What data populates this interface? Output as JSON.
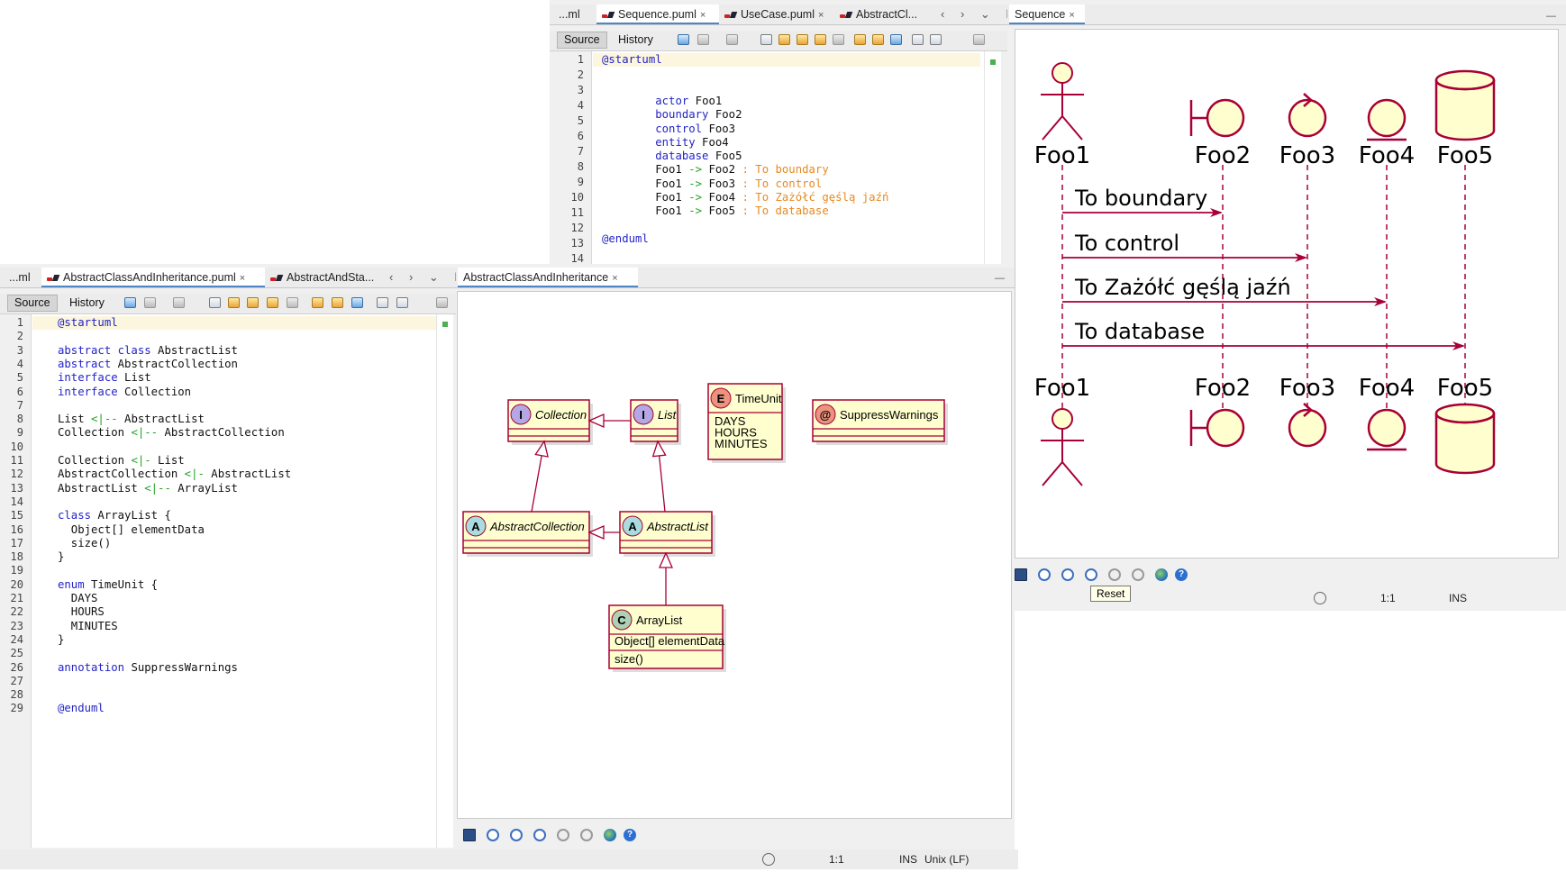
{
  "top_editor": {
    "tabs": [
      {
        "label": "...ml"
      },
      {
        "label": "Sequence.puml",
        "close": "×"
      },
      {
        "label": "UseCase.puml",
        "close": "×"
      },
      {
        "label": "AbstractCl..."
      }
    ],
    "nav": "‹ › ⌄ ☐",
    "source_label": "Source",
    "history_label": "History",
    "line_numbers": [
      "1",
      "2",
      "3",
      "4",
      "5",
      "6",
      "7",
      "8",
      "9",
      "10",
      "11",
      "12",
      "13",
      "14"
    ]
  },
  "sequence_viewer": {
    "tab_label": "Sequence",
    "tab_close": "×",
    "minimize": "—",
    "participants": [
      "Foo1",
      "Foo2",
      "Foo3",
      "Foo4",
      "Foo5"
    ],
    "messages": [
      "To boundary",
      "To control",
      "To Zażółć gęślą jaźń",
      "To database"
    ],
    "tooltip": "Reset"
  },
  "sequence_status": {
    "line_col": "1:1",
    "mode": "INS"
  },
  "bottom_editor": {
    "tabs": [
      {
        "label": "...ml"
      },
      {
        "label": "AbstractClassAndInheritance.puml",
        "close": "×"
      },
      {
        "label": "AbstractAndSta..."
      }
    ],
    "nav": "‹ › ⌄ ☐",
    "source_label": "Source",
    "history_label": "History",
    "line_numbers": [
      "1",
      "2",
      "3",
      "4",
      "5",
      "6",
      "7",
      "8",
      "9",
      "10",
      "11",
      "12",
      "13",
      "14",
      "15",
      "16",
      "17",
      "18",
      "19",
      "20",
      "21",
      "22",
      "23",
      "24",
      "25",
      "26",
      "27",
      "28",
      "29"
    ]
  },
  "class_viewer": {
    "tab_label": "AbstractClassAndInheritance",
    "tab_close": "×",
    "minimize": "—",
    "classes": {
      "collection": {
        "stereo": "I",
        "name": "Collection",
        "color": "#b4a7e5"
      },
      "list": {
        "stereo": "I",
        "name": "List",
        "color": "#b4a7e5"
      },
      "timeunit": {
        "stereo": "E",
        "name": "TimeUnit",
        "values": [
          "DAYS",
          "HOURS",
          "MINUTES"
        ],
        "color": "#eb937f"
      },
      "suppress": {
        "stereo": "@",
        "name": "SuppressWarnings",
        "color": "#eb937f"
      },
      "abstractcollection": {
        "stereo": "A",
        "name": "AbstractCollection",
        "color": "#a9dcdf"
      },
      "abstractlist": {
        "stereo": "A",
        "name": "AbstractList",
        "color": "#a9dcdf"
      },
      "arraylist": {
        "stereo": "C",
        "name": "ArrayList",
        "field": "Object[] elementData",
        "method": "size()",
        "color": "#add1b2"
      }
    }
  },
  "bottom_status": {
    "line_col": "1:1",
    "mode": "INS",
    "eol": "Unix (LF)"
  },
  "colors": {
    "accent": "#a80036",
    "uml_fill": "#fefece",
    "keyword": "#2323c8",
    "arrow": "#22a222",
    "string": "#e68a22"
  }
}
